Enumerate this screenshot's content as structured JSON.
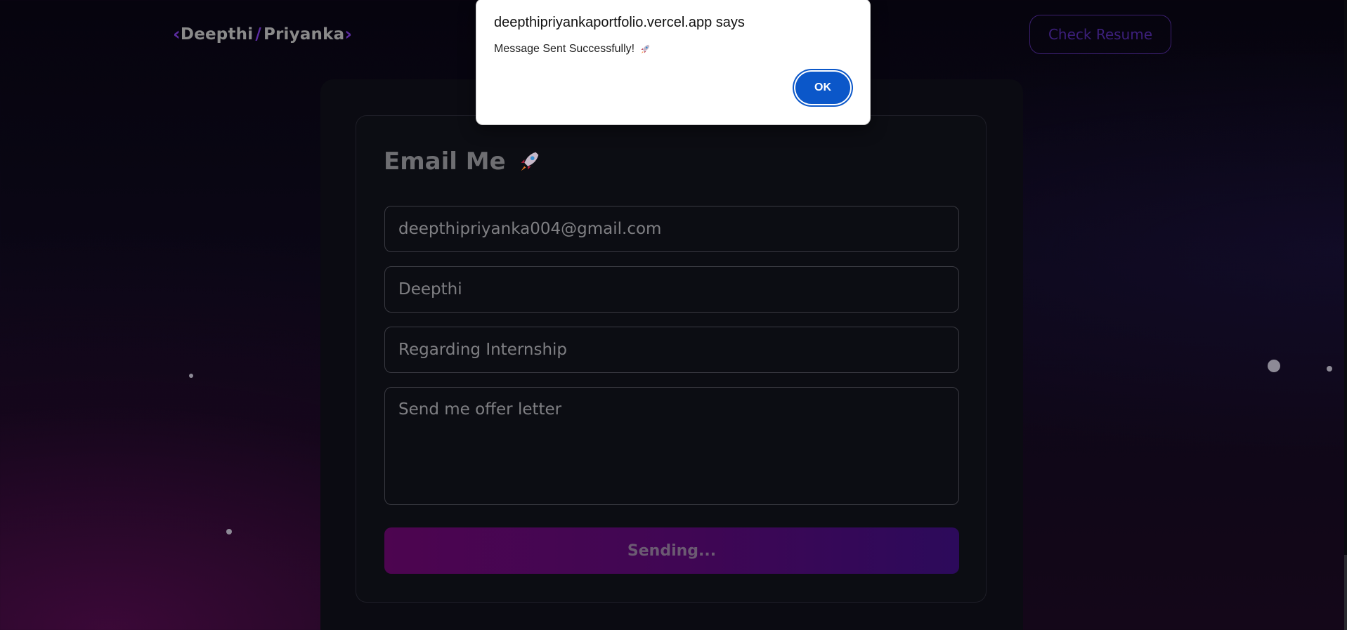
{
  "navbar": {
    "logo_first": "Deepthi",
    "logo_slash": "/",
    "logo_second": "Priyanka",
    "resume_button": "Check Resume"
  },
  "form": {
    "title": "Email Me",
    "email_value": "deepthipriyanka004@gmail.com",
    "name_value": "Deepthi",
    "subject_value": "Regarding Internship",
    "message_value": "Send me offer letter",
    "submit_label": "Sending..."
  },
  "dialog": {
    "title": "deepthipriyankaportfolio.vercel.app says",
    "message": "Message Sent Successfully!",
    "ok_label": "OK"
  },
  "icons": {
    "title_icon": "rocket-icon",
    "message_icon": "rocket-icon"
  },
  "colors": {
    "accent_purple": "#5b2ca0",
    "send_button": "#4d0550",
    "dialog_button": "#0b57c9"
  }
}
